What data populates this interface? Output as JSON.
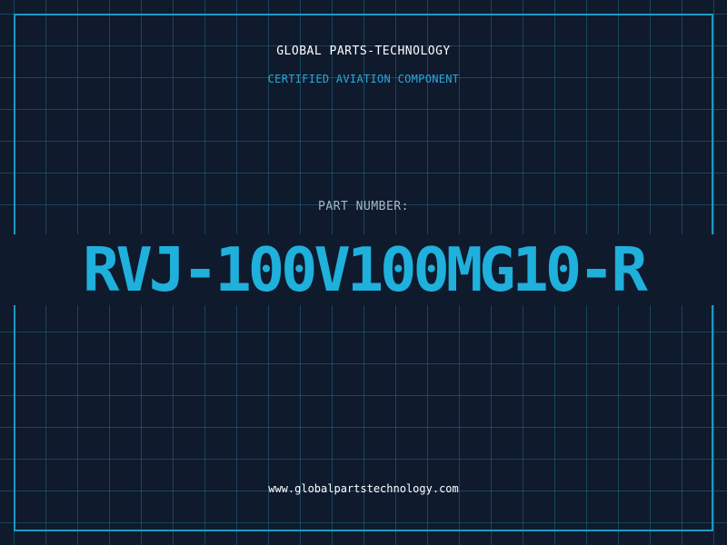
{
  "header": {
    "company_name": "GLOBAL PARTS-TECHNOLOGY",
    "subtitle": "CERTIFIED AVIATION COMPONENT"
  },
  "part": {
    "label": "PART NUMBER:",
    "number": "RVJ-100V100MG10-R"
  },
  "footer": {
    "website": "www.globalpartstechnology.com"
  },
  "colors": {
    "background": "#0f1a2d",
    "grid": "#287896",
    "accent": "#1fb0dc",
    "frame": "#1a9bc4",
    "label": "#aab6c4",
    "text": "#ffffff"
  }
}
